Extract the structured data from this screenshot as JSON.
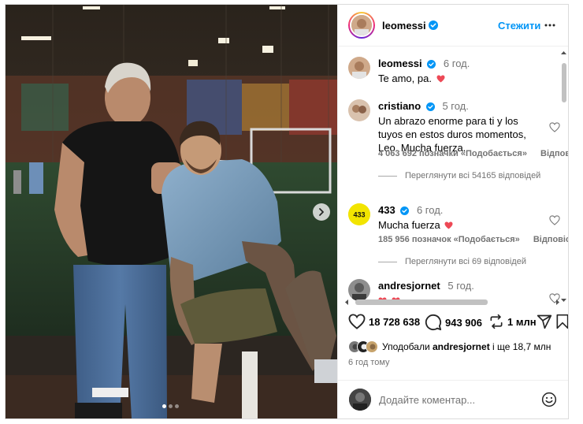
{
  "post": {
    "author": "leomessi",
    "follow_label": "Стежити"
  },
  "comments": [
    {
      "user": "leomessi",
      "time": "6 год.",
      "text": "Te amo, pa."
    },
    {
      "user": "cristiano",
      "time": "5 год.",
      "text": "Un abrazo enorme para ti y los tuyos en estos duros momentos, Leo. Mucha fuerza.",
      "likes": "4 063 692 позначки «Подобається»",
      "reply": "Відповісти",
      "view_replies": "Переглянути всі 54165 відповідей"
    },
    {
      "user": "433",
      "time": "6 год.",
      "text": "Mucha fuerza",
      "likes": "185 956 позначок «Подобається»",
      "reply": "Відповісти",
      "view_replies": "Переглянути всі 69 відповідей"
    },
    {
      "user": "andresjornet",
      "time": "5 год.",
      "text": ""
    }
  ],
  "actions": {
    "likes_count": "18 728 638",
    "comments_count": "943 906",
    "reposts_count": "1 млн"
  },
  "liked_by": {
    "prefix": "Уподобали",
    "user": "andresjornet",
    "suffix": "і ще 18,7 млн"
  },
  "timestamp": "6 год тому",
  "add_comment": {
    "placeholder": "Додайте коментар..."
  },
  "colors": {
    "accent": "#0095f6",
    "heart": "#ed4956",
    "secondary_text": "#737373",
    "verified": "#0095f6"
  },
  "carousel": {
    "slide_count": 3,
    "active_index": 0
  },
  "icons": [
    "verified-badge-icon",
    "more-options-icon",
    "heart-icon",
    "comment-icon",
    "repost-icon",
    "share-icon",
    "save-icon",
    "emoji-icon",
    "chevron-right-icon"
  ]
}
